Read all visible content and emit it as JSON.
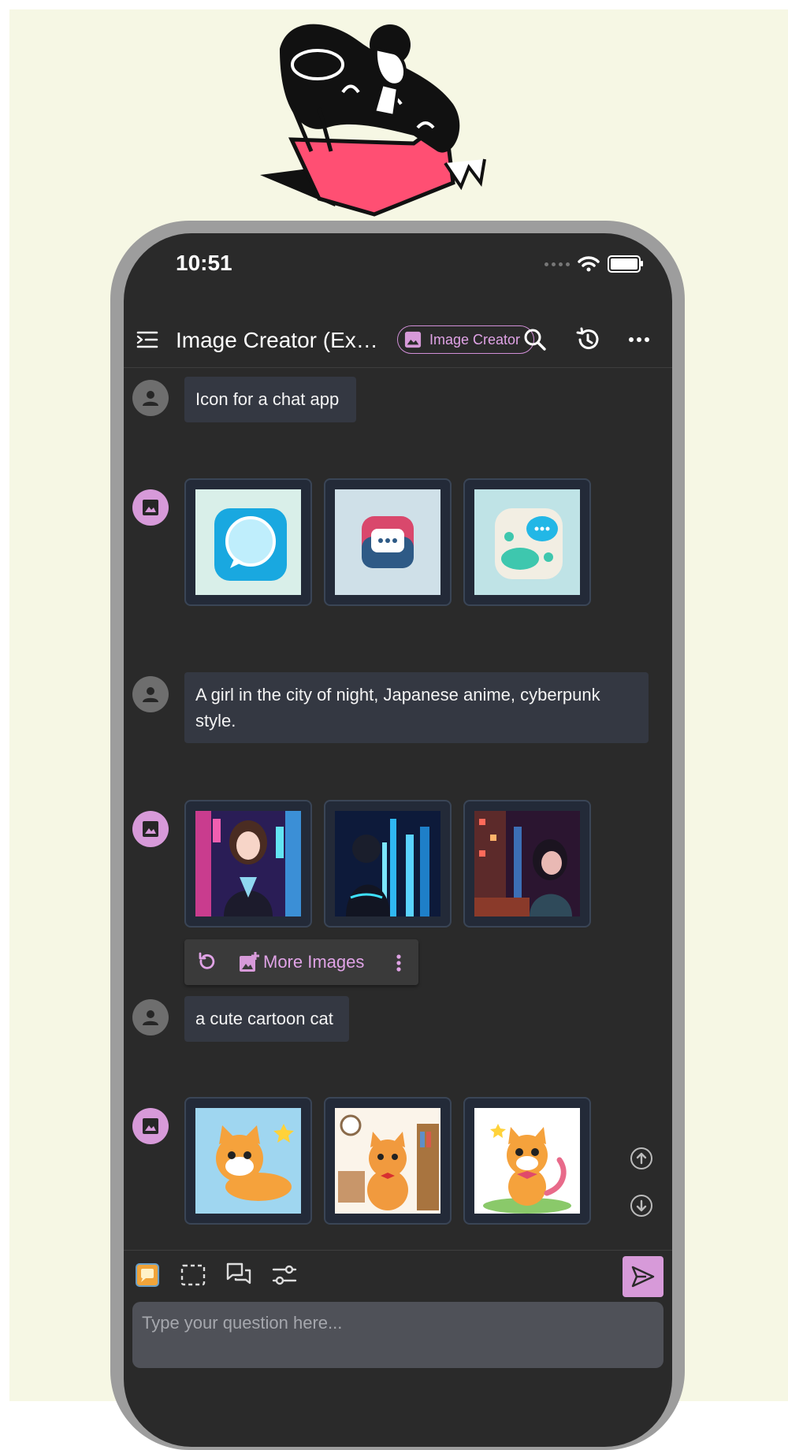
{
  "status_bar": {
    "time": "10:51"
  },
  "header": {
    "title": "Image Creator (Ex…",
    "chip_label": "Image Creator"
  },
  "messages": [
    {
      "role": "user",
      "text": "Icon for a chat app"
    },
    {
      "role": "bot",
      "images": [
        "chat-bubble-icon-image",
        "chat-dots-icon-image",
        "chat-cluster-icon-image"
      ]
    },
    {
      "role": "user",
      "text": "A girl in the city of night, Japanese anime, cyberpunk style."
    },
    {
      "role": "bot",
      "images": [
        "anime-girl-neon-street-image",
        "anime-girl-skyline-image",
        "anime-girl-night-city-image"
      ]
    },
    {
      "role": "user",
      "text": "a cute cartoon cat"
    },
    {
      "role": "bot",
      "images": [
        "cartoon-cat-lying-image",
        "cartoon-cat-library-image",
        "cartoon-cat-bowtie-image"
      ]
    }
  ],
  "actions": {
    "more_images_label": "More Images"
  },
  "composer": {
    "placeholder": "Type your question here..."
  },
  "colors": {
    "accent": "#d79ad9",
    "screen_bg": "#2a2a2a",
    "bubble_bg": "#343842",
    "page_bg": "#f6f7e4"
  }
}
